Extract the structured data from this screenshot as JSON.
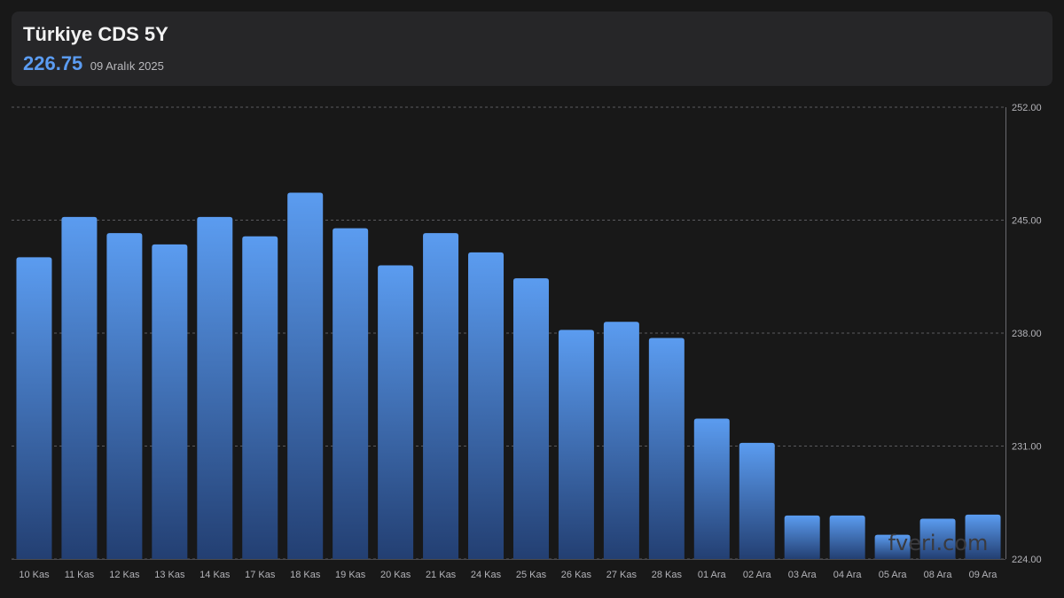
{
  "header": {
    "title": "Türkiye CDS 5Y",
    "current_value": "226.75",
    "current_date": "09 Aralık 2025"
  },
  "watermark": "fveri.com",
  "colors": {
    "background": "#181818",
    "card": "#262628",
    "accent": "#5b9cf2",
    "bar_top": "#5b9cf0",
    "bar_bottom": "#233f72",
    "grid": "#5a5a5e"
  },
  "chart_data": {
    "type": "bar",
    "title": "Türkiye CDS 5Y",
    "xlabel": "",
    "ylabel": "",
    "categories": [
      "10 Kas",
      "11 Kas",
      "12 Kas",
      "13 Kas",
      "14 Kas",
      "17 Kas",
      "18 Kas",
      "19 Kas",
      "20 Kas",
      "21 Kas",
      "24 Kas",
      "25 Kas",
      "26 Kas",
      "27 Kas",
      "28 Kas",
      "01 Ara",
      "02 Ara",
      "03 Ara",
      "04 Ara",
      "05 Ara",
      "08 Ara",
      "09 Ara"
    ],
    "values": [
      242.7,
      245.2,
      244.2,
      243.5,
      245.2,
      244.0,
      246.7,
      244.5,
      242.2,
      244.2,
      243.0,
      241.4,
      238.2,
      238.7,
      237.7,
      232.7,
      231.2,
      226.7,
      226.7,
      225.5,
      226.5,
      226.75
    ],
    "ylim": [
      224,
      252
    ],
    "yticks": [
      "252.00",
      "245.00",
      "238.00",
      "231.00",
      "224.00"
    ],
    "ytick_values": [
      252,
      245,
      238,
      231,
      224
    ],
    "grid": true,
    "legend": "none"
  }
}
